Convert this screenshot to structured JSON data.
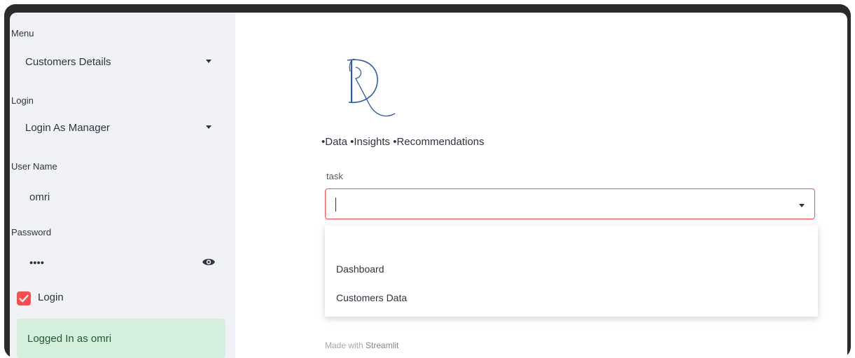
{
  "sidebar": {
    "menu_label": "Menu",
    "menu_value": "Customers Details",
    "login_label": "Login",
    "login_value": "Login As Manager",
    "username_label": "User Name",
    "username_value": "omri",
    "password_label": "Password",
    "password_value": "••••",
    "checkbox_label": "Login",
    "checkbox_checked": true,
    "success_message": "Logged In as omri"
  },
  "main": {
    "logo_letters": "DR",
    "tagline": "•Data •Insights •Recommendations",
    "task_label": "task",
    "task_value": "",
    "options": [
      "Dashboard",
      "Customers Data"
    ],
    "footer_prefix": "Made with ",
    "footer_brand": "Streamlit"
  },
  "colors": {
    "accent": "#ff4b4b",
    "sidebar_bg": "#f0f2f6",
    "success_bg": "#d4f0dd",
    "logo_blue": "#2f5aa8"
  },
  "icons": {
    "caret": "chevron-down-icon",
    "eye": "eye-icon",
    "check": "check-icon"
  }
}
